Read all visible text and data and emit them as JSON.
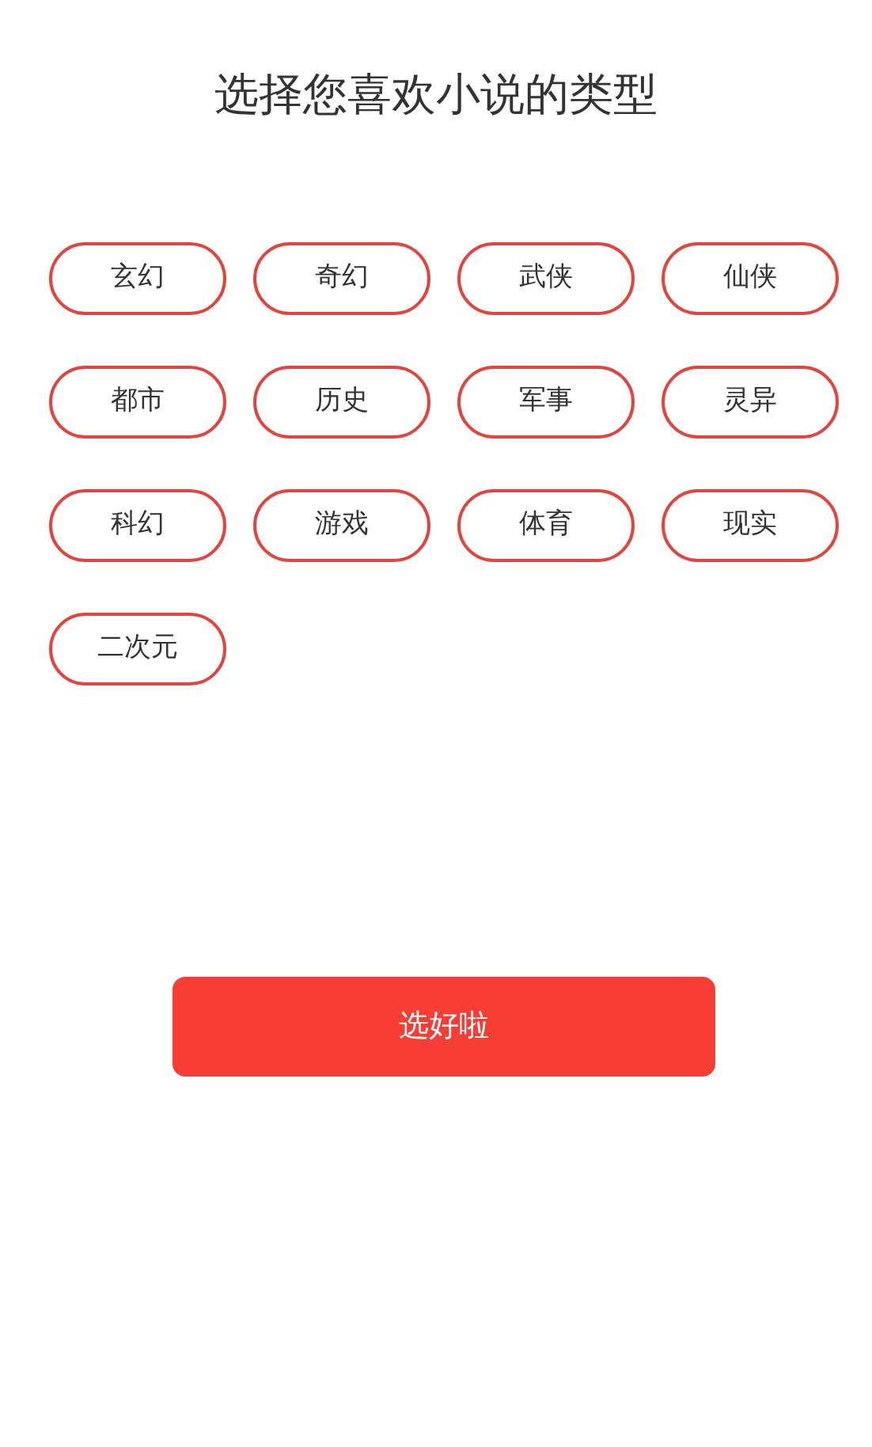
{
  "title": "选择您喜欢小说的类型",
  "genres": [
    {
      "label": "玄幻",
      "selected": false
    },
    {
      "label": "奇幻",
      "selected": false
    },
    {
      "label": "武侠",
      "selected": false
    },
    {
      "label": "仙侠",
      "selected": false
    },
    {
      "label": "都市",
      "selected": false
    },
    {
      "label": "历史",
      "selected": false
    },
    {
      "label": "军事",
      "selected": false
    },
    {
      "label": "灵异",
      "selected": false
    },
    {
      "label": "科幻",
      "selected": false
    },
    {
      "label": "游戏",
      "selected": false
    },
    {
      "label": "体育",
      "selected": false
    },
    {
      "label": "现实",
      "selected": false
    },
    {
      "label": "二次元",
      "selected": false
    }
  ],
  "confirm_button": "选好啦"
}
